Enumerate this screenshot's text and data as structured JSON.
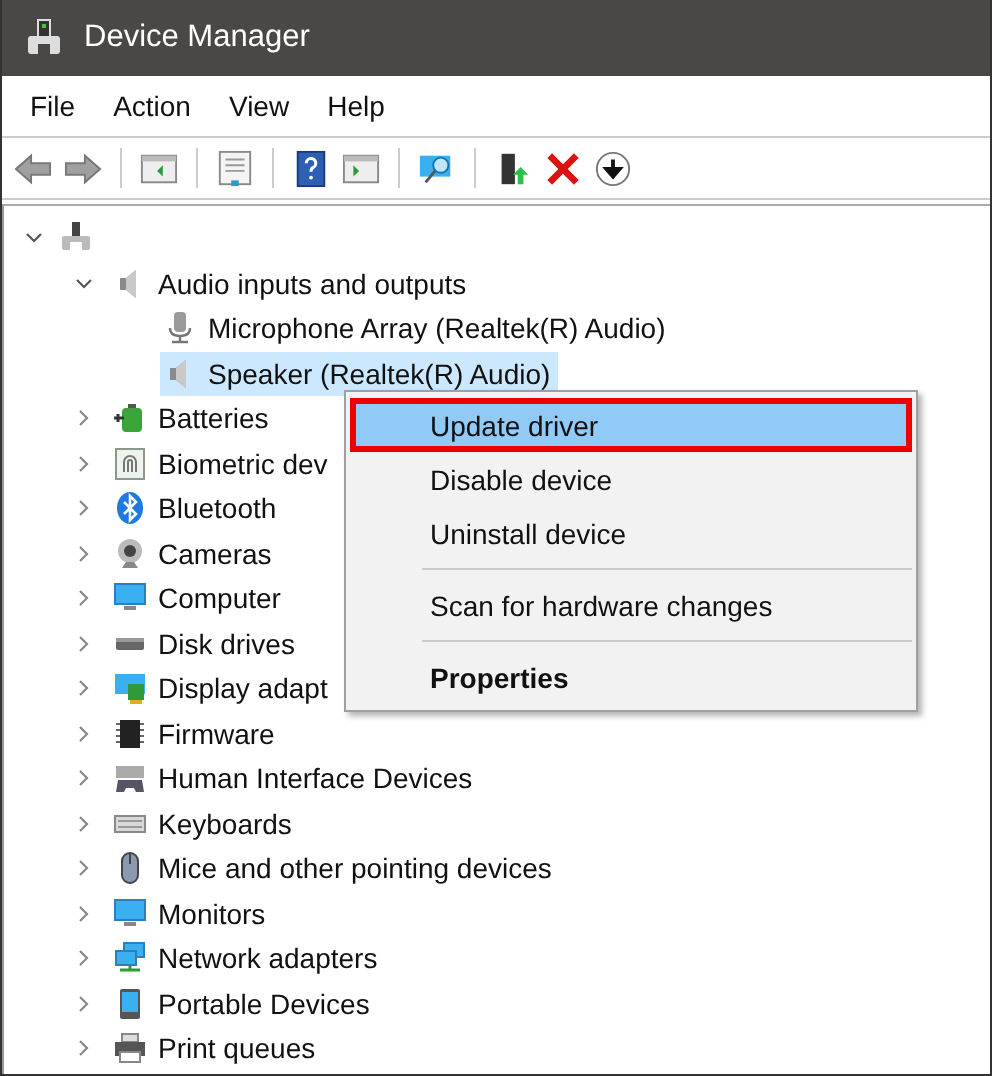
{
  "window": {
    "title": "Device Manager"
  },
  "menu_bar": [
    "File",
    "Action",
    "View",
    "Help"
  ],
  "toolbar": {
    "back_disabled": true,
    "forward_disabled": true
  },
  "tree": {
    "expanded": true,
    "children": [
      {
        "label": "Audio inputs and outputs",
        "expanded": true,
        "selected": false,
        "children": [
          {
            "label": "Microphone Array (Realtek(R) Audio)",
            "selected": false
          },
          {
            "label": "Speaker (Realtek(R) Audio)",
            "selected": true
          }
        ]
      },
      {
        "label": "Batteries",
        "expanded": false,
        "selected": false
      },
      {
        "label": "Biometric dev",
        "expanded": false,
        "selected": false
      },
      {
        "label": "Bluetooth",
        "expanded": false,
        "selected": false
      },
      {
        "label": "Cameras",
        "expanded": false,
        "selected": false
      },
      {
        "label": "Computer",
        "expanded": false,
        "selected": false
      },
      {
        "label": "Disk drives",
        "expanded": false,
        "selected": false
      },
      {
        "label": "Display adapt",
        "expanded": false,
        "selected": false
      },
      {
        "label": "Firmware",
        "expanded": false,
        "selected": false
      },
      {
        "label": "Human Interface Devices",
        "expanded": false,
        "selected": false
      },
      {
        "label": "Keyboards",
        "expanded": false,
        "selected": false
      },
      {
        "label": "Mice and other pointing devices",
        "expanded": false,
        "selected": false
      },
      {
        "label": "Monitors",
        "expanded": false,
        "selected": false
      },
      {
        "label": "Network adapters",
        "expanded": false,
        "selected": false
      },
      {
        "label": "Portable Devices",
        "expanded": false,
        "selected": false
      },
      {
        "label": "Print queues",
        "expanded": false,
        "selected": false
      }
    ]
  },
  "context_menu": [
    {
      "kind": "item",
      "label": "Update driver",
      "selected": true,
      "default": false
    },
    {
      "kind": "item",
      "label": "Disable device",
      "selected": false,
      "default": false
    },
    {
      "kind": "item",
      "label": "Uninstall device",
      "selected": false,
      "default": false
    },
    {
      "kind": "separator"
    },
    {
      "kind": "item",
      "label": "Scan for hardware changes",
      "selected": false,
      "default": false
    },
    {
      "kind": "separator"
    },
    {
      "kind": "item",
      "label": "Properties",
      "selected": false,
      "default": true
    }
  ]
}
